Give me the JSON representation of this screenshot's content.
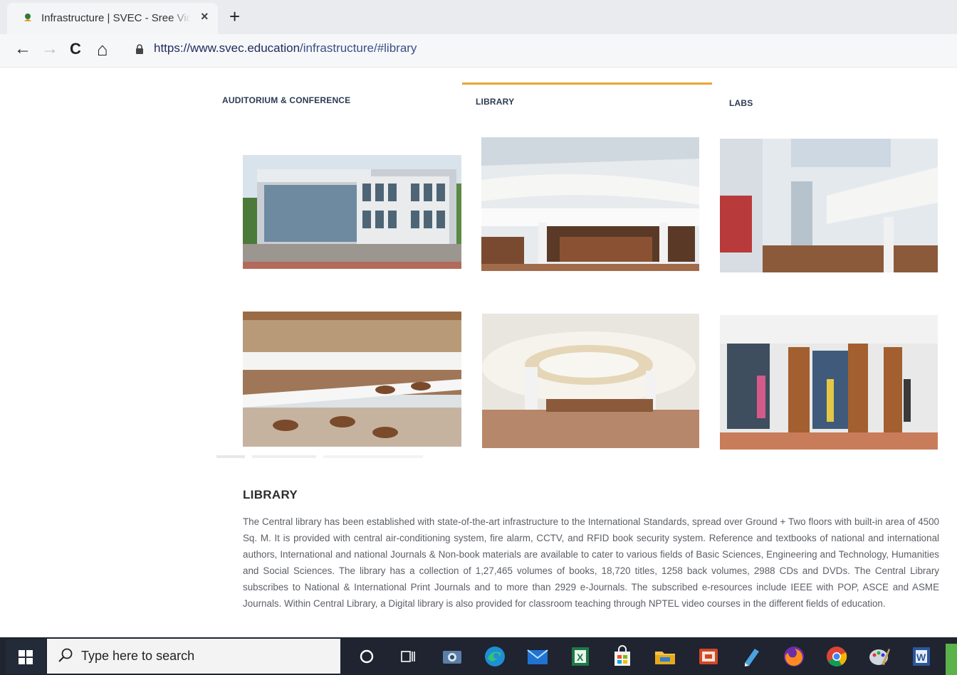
{
  "browser": {
    "tab_title": "Infrastructure | SVEC - Sree Vidyanikethan Engineering College",
    "tab_close": "×",
    "new_tab": "+",
    "url_host": "https://www.svec.education",
    "url_path": "/infrastructure/#library",
    "back": "←",
    "forward": "→",
    "reload": "C",
    "home": "⌂"
  },
  "tabs": {
    "auditorium": "AUDITORIUM & CONFERENCE",
    "library": "LIBRARY",
    "labs": "LABS",
    "active": "library"
  },
  "gallery": {
    "photos": [
      {
        "subject": "library-building-exterior"
      },
      {
        "subject": "library-atrium-reception"
      },
      {
        "subject": "library-atrium-skylight"
      },
      {
        "subject": "library-reading-floors"
      },
      {
        "subject": "library-reading-hall"
      },
      {
        "subject": "library-bookstacks-students"
      }
    ]
  },
  "section": {
    "title": "LIBRARY",
    "body": "The Central library has been established with state-of-the-art infrastructure to the International Standards, spread over Ground + Two floors with built-in area of 4500 Sq. M. It is provided with central air-conditioning system, fire alarm, CCTV, and RFID book security system. Reference and textbooks of national and international authors, International and national Journals & Non-book materials are available to cater to various fields of Basic Sciences, Engineering and Technology, Humanities and Social Sciences. The library has a collection of 1,27,465 volumes of books, 18,720 titles, 1258 back volumes, 2988 CDs and DVDs. The Central Library subscribes to National & International Print Journals and to more than 2929 e-Journals. The subscribed e-resources include IEEE with POP, ASCE and ASME Journals. Within Central Library, a Digital library is also provided for classroom teaching through NPTEL video courses in the different fields of education."
  },
  "taskbar": {
    "search_placeholder": "Type here to search",
    "apps": [
      "cortana-icon",
      "task-view-icon",
      "camera-icon",
      "edge-icon",
      "mail-icon",
      "excel-icon",
      "store-icon",
      "file-explorer-icon",
      "presentation-icon",
      "pen-app-icon",
      "firefox-icon",
      "chrome-icon",
      "paint-icon",
      "word-icon"
    ]
  },
  "colors": {
    "accent_underline": "#e8a635",
    "taskbar_bg": "#1f2430",
    "heading": "#2d2d2d"
  }
}
